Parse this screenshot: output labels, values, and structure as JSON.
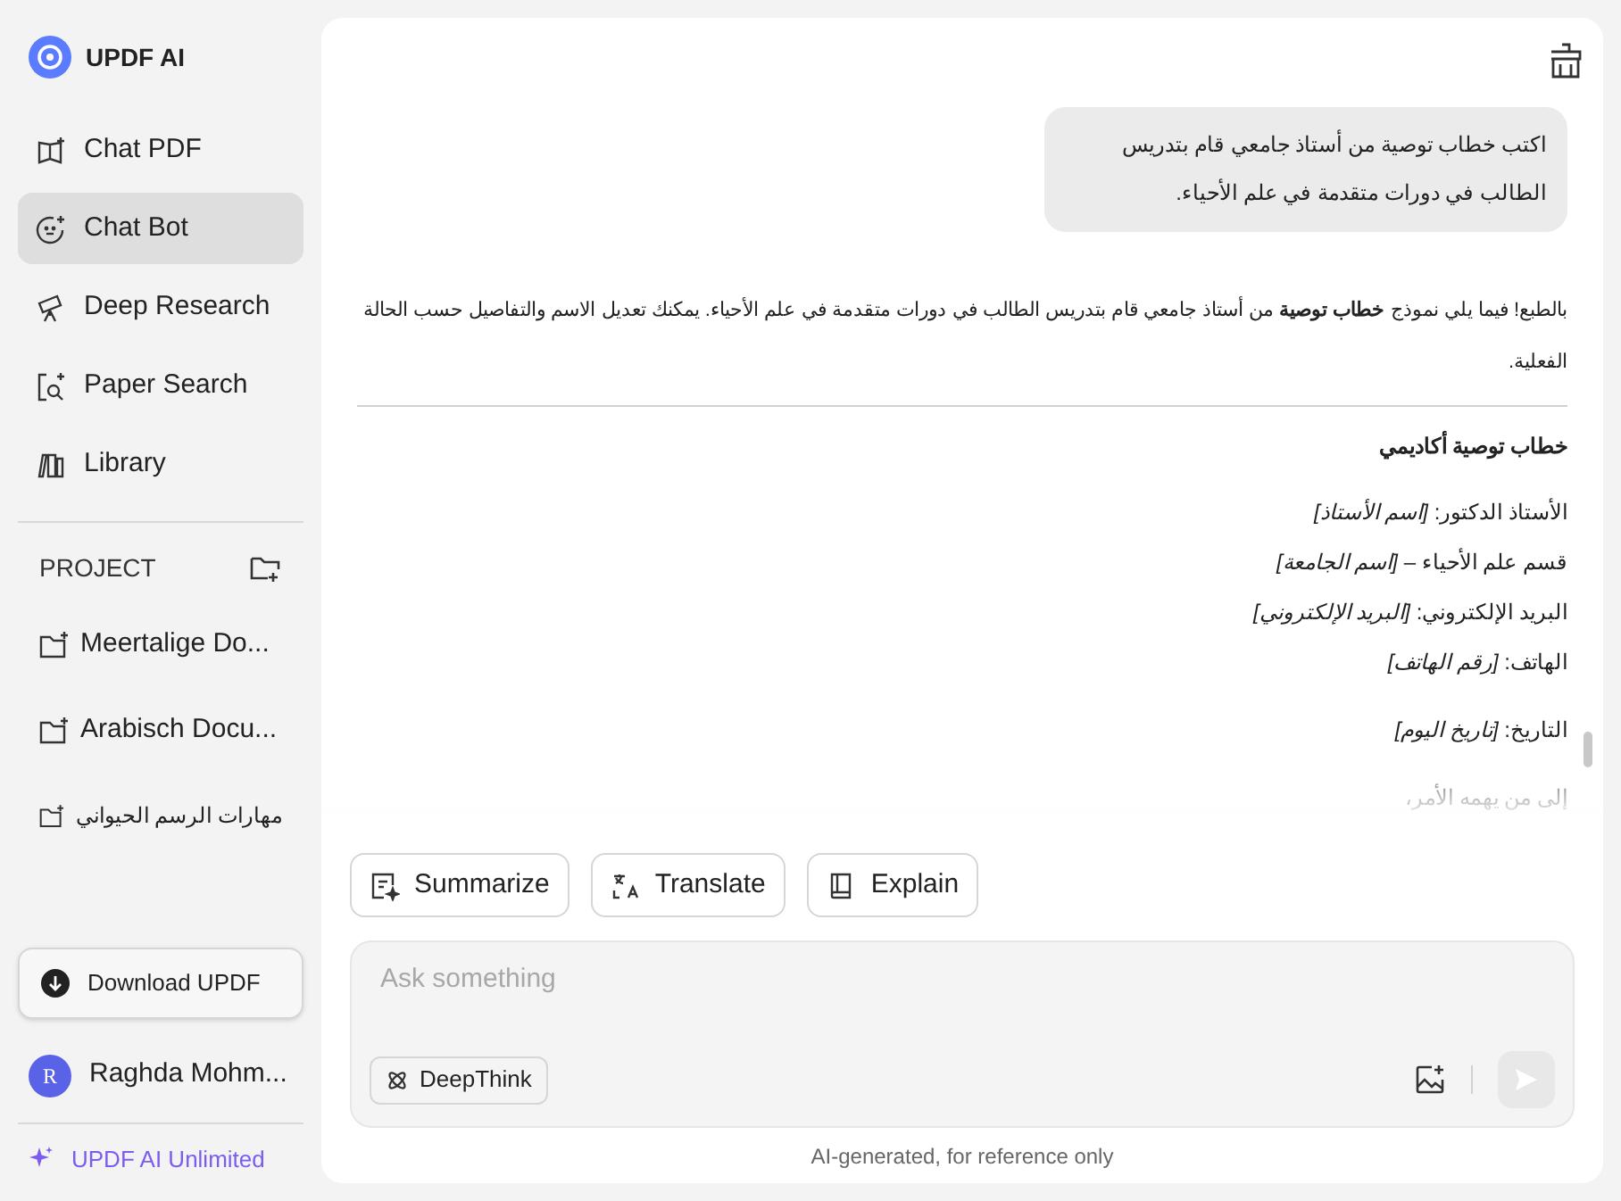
{
  "brand": {
    "name": "UPDF AI"
  },
  "nav": [
    {
      "label": "Chat PDF",
      "selected": false
    },
    {
      "label": "Chat Bot",
      "selected": true
    },
    {
      "label": "Deep Research",
      "selected": false
    },
    {
      "label": "Paper Search",
      "selected": false
    },
    {
      "label": "Library",
      "selected": false
    }
  ],
  "project": {
    "title": "PROJECT",
    "items": [
      "Meertalige Do...",
      "Arabisch Docu...",
      "مهارات الرسم الحيواني"
    ]
  },
  "download": {
    "label": "Download UPDF"
  },
  "user": {
    "initial": "R",
    "name": "Raghda Mohm..."
  },
  "plan": {
    "label": "UPDF AI Unlimited"
  },
  "chat": {
    "user_message": "اكتب خطاب توصية من أستاذ جامعي قام بتدريس الطالب في دورات متقدمة في علم الأحياء.",
    "reply_intro": "بالطبع! فيما يلي نموذج **خطاب توصية** من أستاذ جامعي قام بتدريس الطالب في دورات متقدمة في علم الأحياء. يمكنك تعديل الاسم والتفاصيل حسب الحالة الفعلية.",
    "reply_heading": "خطاب توصية أكاديمي",
    "reply_paragraphs": [
      [
        "الأستاذ الدكتور: *[اسم الأستاذ]*",
        "قسم علم الأحياء – *[اسم الجامعة]*",
        "البريد الإلكتروني: *[البريد الإلكتروني]*",
        "الهاتف: *[رقم الهاتف]*"
      ],
      [
        "التاريخ: *[تاريخ اليوم]*"
      ],
      [
        "إلى من يهمه الأمر،"
      ]
    ]
  },
  "quick_actions": {
    "summarize": {
      "label": "Summarize"
    },
    "translate": {
      "label": "Translate"
    },
    "explain": {
      "label": "Explain"
    }
  },
  "input": {
    "placeholder": "Ask something",
    "deepthink": {
      "label": "DeepThink",
      "on": false
    }
  },
  "footer_note": "AI-generated, for reference only"
}
